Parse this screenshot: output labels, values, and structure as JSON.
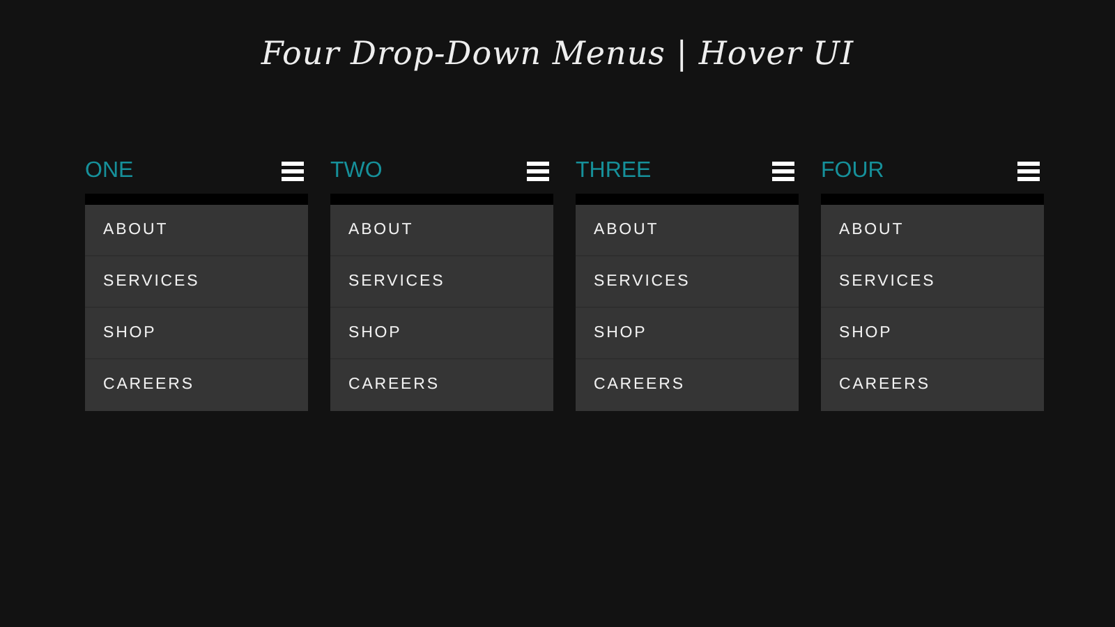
{
  "title": "Four Drop-Down Menus | Hover UI",
  "menus": [
    {
      "label": "ONE",
      "items": [
        "ABOUT",
        "SERVICES",
        "SHOP",
        "CAREERS"
      ]
    },
    {
      "label": "TWO",
      "items": [
        "ABOUT",
        "SERVICES",
        "SHOP",
        "CAREERS"
      ]
    },
    {
      "label": "THREE",
      "items": [
        "ABOUT",
        "SERVICES",
        "SHOP",
        "CAREERS"
      ]
    },
    {
      "label": "FOUR",
      "items": [
        "ABOUT",
        "SERVICES",
        "SHOP",
        "CAREERS"
      ]
    }
  ]
}
